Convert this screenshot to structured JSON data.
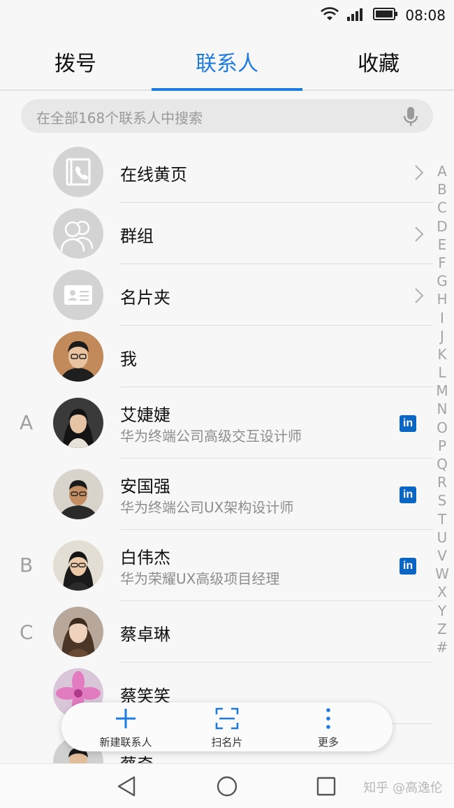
{
  "status_bar": {
    "time": "08:08"
  },
  "tabs": [
    {
      "label": "拨号"
    },
    {
      "label": "联系人",
      "active": true
    },
    {
      "label": "收藏"
    }
  ],
  "search": {
    "placeholder": "在全部168个联系人中搜索"
  },
  "system_entries": [
    {
      "label": "在线黄页"
    },
    {
      "label": "群组"
    },
    {
      "label": "名片夹"
    }
  ],
  "me": {
    "label": "我"
  },
  "contacts": [
    {
      "section": "A",
      "name": "艾婕婕",
      "title": "华为终端公司高级交互设计师",
      "badge": "in"
    },
    {
      "section": "",
      "name": "安国强",
      "title": "华为终端公司UX架构设计师",
      "badge": "in"
    },
    {
      "section": "B",
      "name": "白伟杰",
      "title": "华为荣耀UX高级项目经理",
      "badge": "in"
    },
    {
      "section": "C",
      "name": "蔡卓琳",
      "title": ""
    },
    {
      "section": "",
      "name": "蔡笑笑",
      "title": ""
    },
    {
      "section": "",
      "name": "蔡奇",
      "title": ""
    }
  ],
  "index_letters": [
    "A",
    "B",
    "C",
    "D",
    "E",
    "F",
    "G",
    "H",
    "I",
    "J",
    "K",
    "L",
    "M",
    "N",
    "O",
    "P",
    "Q",
    "R",
    "S",
    "T",
    "U",
    "V",
    "W",
    "X",
    "Y",
    "Z",
    "#"
  ],
  "toolbar": {
    "new_contact": "新建联系人",
    "scan_card": "扫名片",
    "more": "更多"
  },
  "watermark": "知乎 @高逸伦",
  "colors": {
    "accent": "#1e7be0",
    "linkedin": "#0a66c2"
  }
}
